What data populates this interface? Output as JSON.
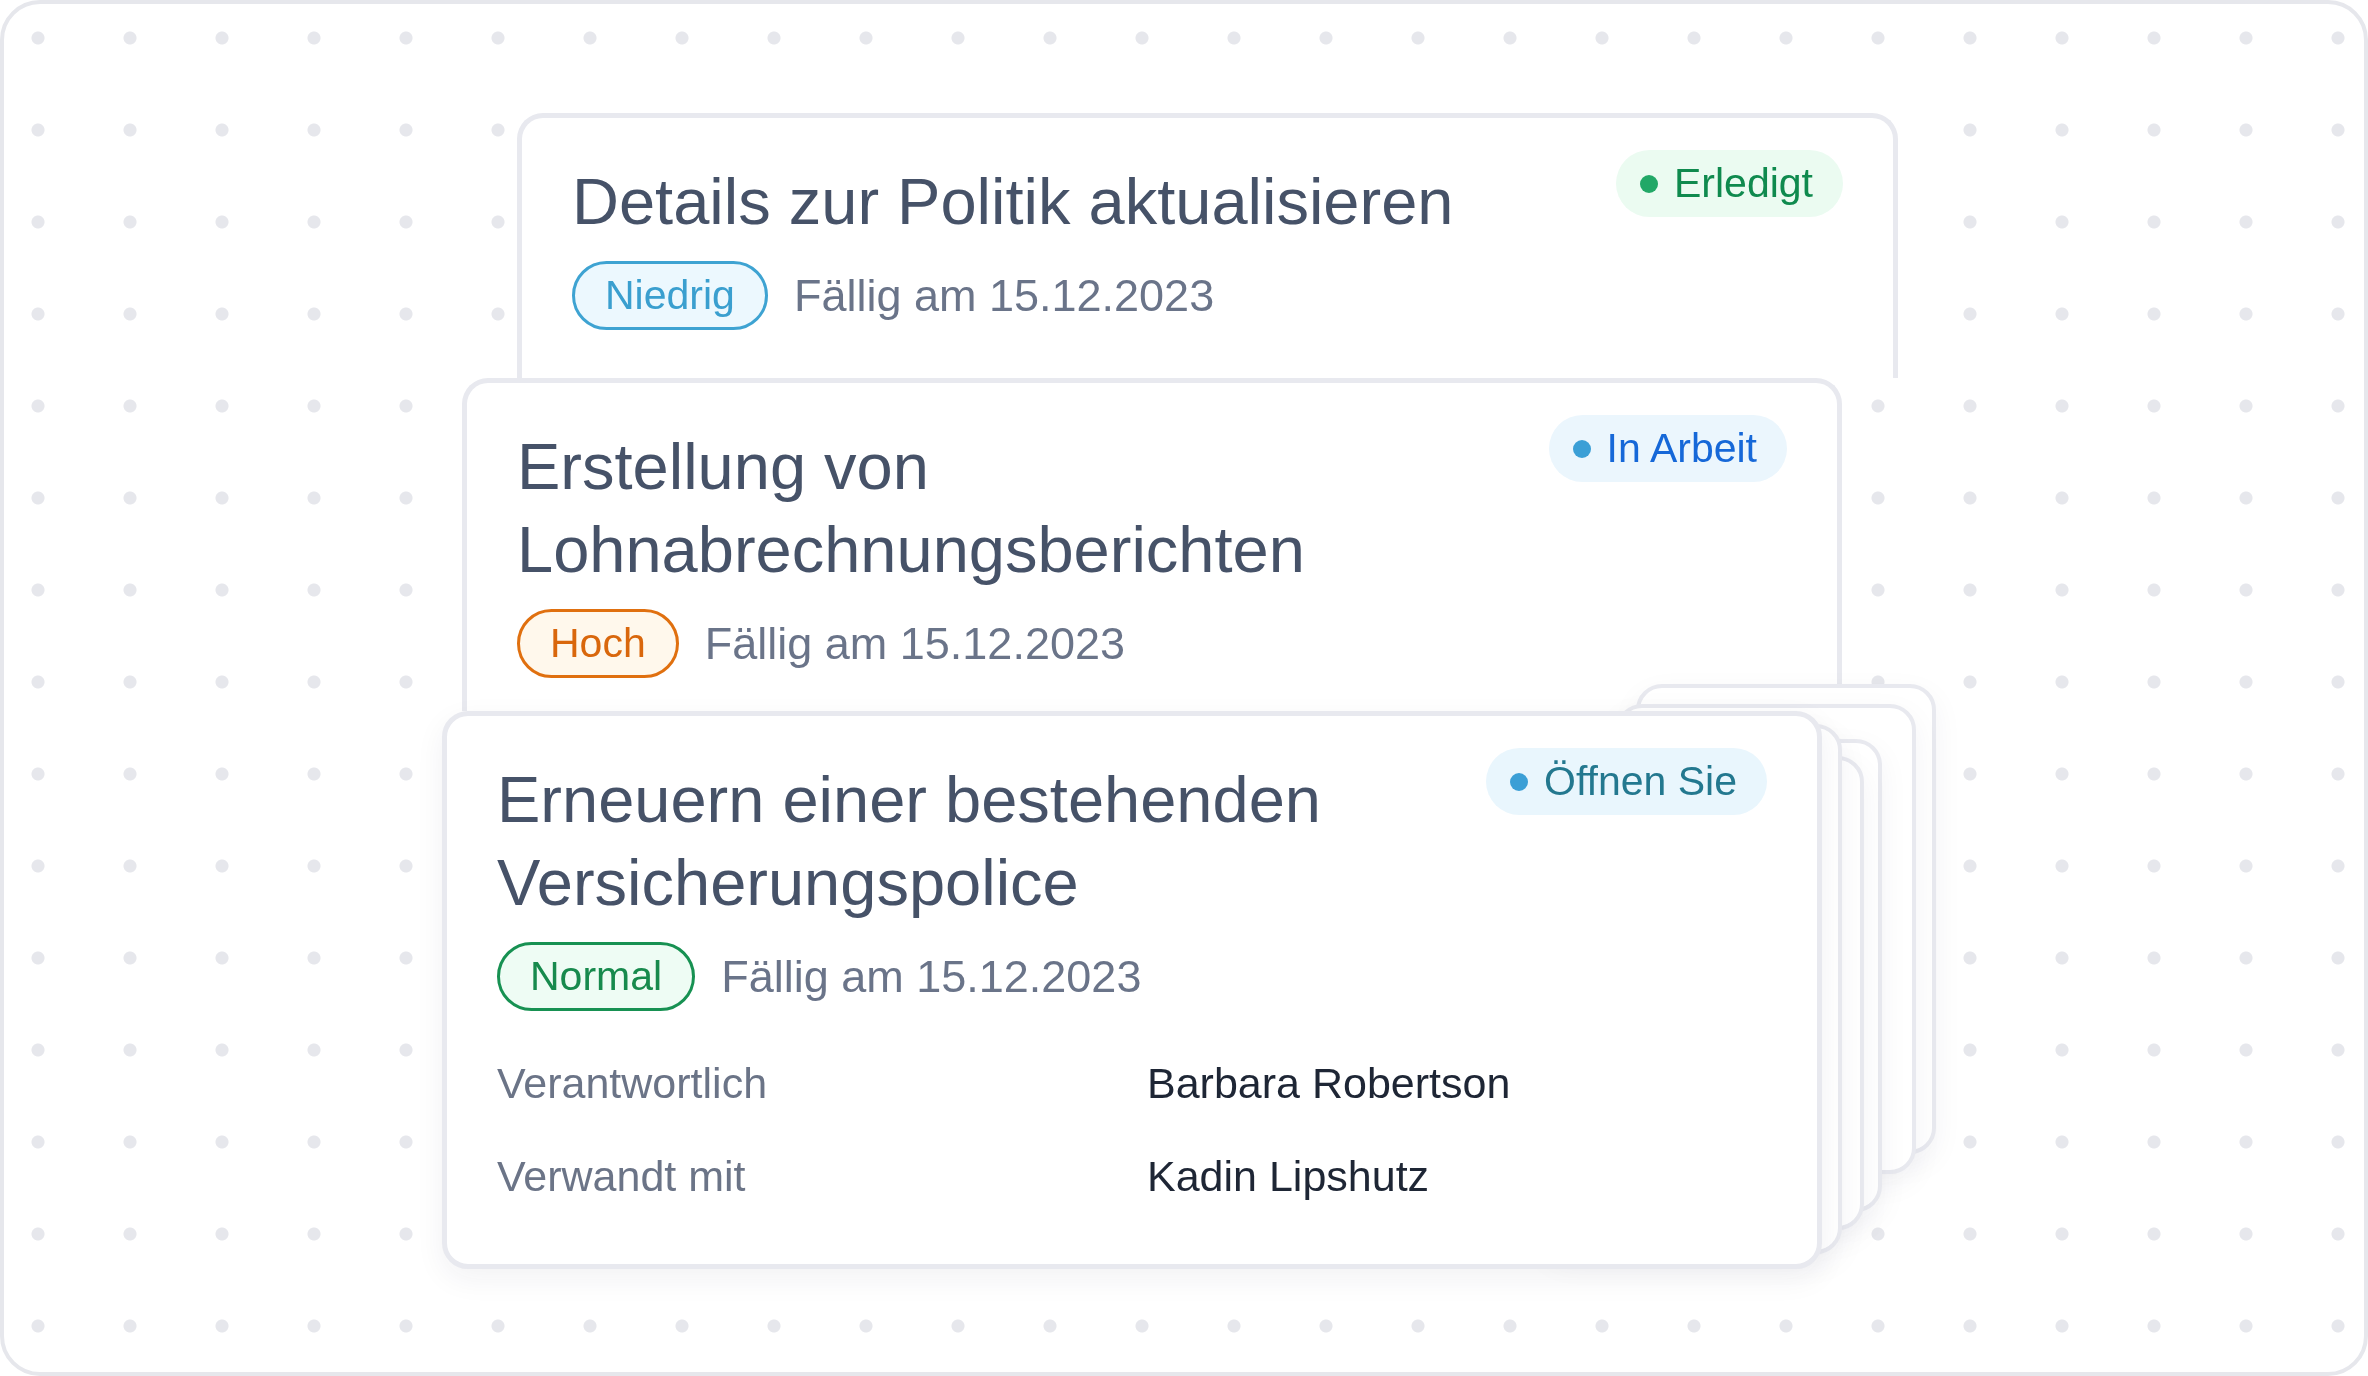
{
  "cards": [
    {
      "title": "Details zur Politik aktualisieren",
      "status": {
        "label": "Erledigt",
        "kind": "done"
      },
      "priority": {
        "label": "Niedrig",
        "kind": "low"
      },
      "due": "Fällig am 15.12.2023"
    },
    {
      "title": "Erstellung von Lohnabrechnungsberichten",
      "status": {
        "label": "In Arbeit",
        "kind": "in_progress"
      },
      "priority": {
        "label": "Hoch",
        "kind": "high"
      },
      "due": "Fällig am 15.12.2023"
    },
    {
      "title": "Erneuern einer bestehenden Versicherungspolice",
      "status": {
        "label": "Öffnen Sie",
        "kind": "open"
      },
      "priority": {
        "label": "Normal",
        "kind": "normal"
      },
      "due": "Fällig am 15.12.2023",
      "fields": [
        {
          "label": "Verantwortlich",
          "value": "Barbara Robertson"
        },
        {
          "label": "Verwandt mit",
          "value": "Kadin Lipshutz"
        }
      ]
    }
  ]
}
